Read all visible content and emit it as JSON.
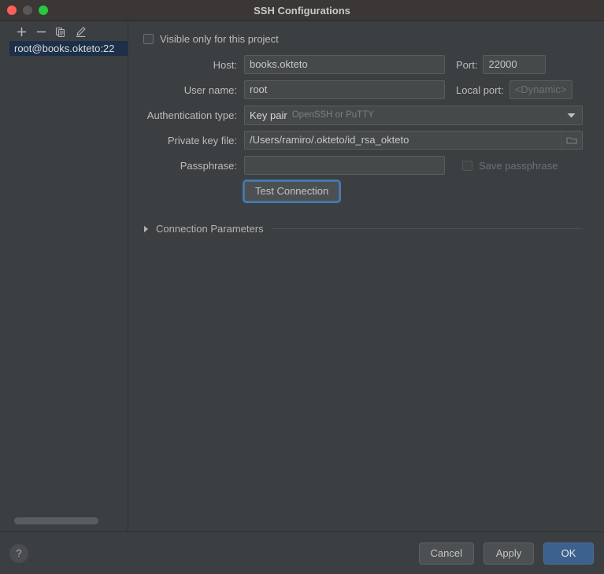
{
  "window": {
    "title": "SSH Configurations",
    "controls": [
      {
        "name": "close",
        "color": "#ff5f57"
      },
      {
        "name": "minimize",
        "color": "#58585a"
      },
      {
        "name": "maximize",
        "color": "#28c840"
      }
    ]
  },
  "sidebar": {
    "toolbar": [
      {
        "icon": "plus-icon",
        "label": "Add"
      },
      {
        "icon": "minus-icon",
        "label": "Remove"
      },
      {
        "icon": "copy-icon",
        "label": "Copy"
      },
      {
        "icon": "edit-pencil-icon",
        "label": "Edit"
      }
    ],
    "items": [
      {
        "label": "root@books.okteto:22",
        "selected": true
      }
    ]
  },
  "form": {
    "visible_only_checkbox": {
      "label": "Visible only for this project",
      "checked": false
    },
    "host": {
      "label": "Host:",
      "value": "books.okteto"
    },
    "port": {
      "label": "Port:",
      "value": "22000"
    },
    "user_name": {
      "label": "User name:",
      "value": "root"
    },
    "local_port": {
      "label": "Local port:",
      "placeholder": "<Dynamic>",
      "value": ""
    },
    "auth_type": {
      "label": "Authentication type:",
      "value": "Key pair",
      "hint": "OpenSSH or PuTTY"
    },
    "private_key_file": {
      "label": "Private key file:",
      "value": "/Users/ramiro/.okteto/id_rsa_okteto",
      "browse_icon": "folder-icon"
    },
    "passphrase": {
      "label": "Passphrase:",
      "value": "",
      "placeholder": ""
    },
    "save_passphrase": {
      "label": "Save passphrase",
      "checked": false,
      "disabled": true
    },
    "test_connection": {
      "label": "Test Connection",
      "focused": true
    },
    "connection_parameters": {
      "label": "Connection Parameters",
      "expanded": false,
      "arrow": "triangle-right-icon"
    }
  },
  "footer": {
    "help_label": "?",
    "cancel_label": "Cancel",
    "apply_label": "Apply",
    "ok_label": "OK"
  },
  "colors": {
    "background": "#3c3f41",
    "titlebar": "#3b3736",
    "field": "#45494a",
    "selection": "#1d3049",
    "accent_blue": "#3c618f",
    "focus_ring": "#417cb8"
  }
}
